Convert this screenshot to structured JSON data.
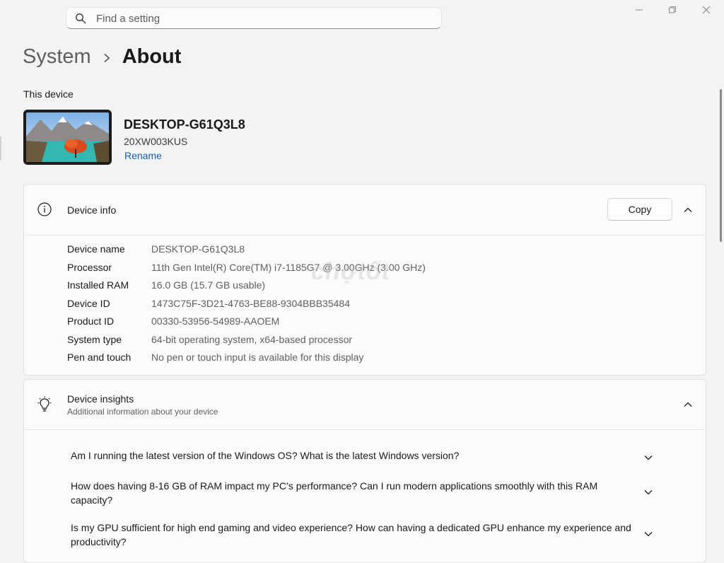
{
  "search": {
    "placeholder": "Find a setting"
  },
  "breadcrumb": {
    "parent": "System",
    "separator": "›",
    "current": "About"
  },
  "this_device": {
    "section_label": "This device",
    "name": "DESKTOP-G61Q3L8",
    "model": "20XW003KUS",
    "rename_label": "Rename"
  },
  "device_info": {
    "title": "Device info",
    "copy_label": "Copy",
    "rows": [
      {
        "key": "Device name",
        "value": "DESKTOP-G61Q3L8"
      },
      {
        "key": "Processor",
        "value": "11th Gen Intel(R) Core(TM) i7-1185G7 @ 3.00GHz (3.00 GHz)"
      },
      {
        "key": "Installed RAM",
        "value": "16.0 GB (15.7 GB usable)"
      },
      {
        "key": "Device ID",
        "value": "1473C75F-3D21-4763-BE88-9304BBB35484"
      },
      {
        "key": "Product ID",
        "value": "00330-53956-54989-AAOEM"
      },
      {
        "key": "System type",
        "value": "64-bit operating system, x64-based processor"
      },
      {
        "key": "Pen and touch",
        "value": "No pen or touch input is available for this display"
      }
    ]
  },
  "device_insights": {
    "title": "Device insights",
    "subtitle": "Additional information about your device",
    "questions": [
      "Am I running the latest version of the Windows OS? What is the latest Windows version?",
      "How does having 8-16 GB of RAM impact my PC’s performance? Can I run modern applications smoothly with this RAM capacity?",
      "Is my GPU sufficient for high end gaming and video experience? How can having a dedicated GPU enhance my experience and productivity?"
    ]
  },
  "watermark": "chợtốt",
  "icons": {
    "search": "search-icon",
    "minimize": "minimize-icon",
    "restore": "restore-icon",
    "close": "close-icon",
    "chevron_right": "chevron-right-icon",
    "info": "info-icon",
    "lightbulb": "lightbulb-icon",
    "chevron_up": "chevron-up-icon",
    "chevron_down": "chevron-down-icon"
  },
  "colors": {
    "accent_link": "#1a5fb4",
    "background": "#f3f3f3",
    "card": "#fbfbfb"
  }
}
